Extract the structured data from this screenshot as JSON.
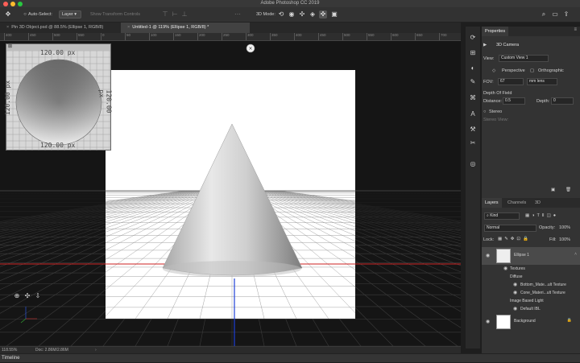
{
  "app": {
    "title": "Adobe Photoshop CC 2019"
  },
  "options_bar": {
    "auto_select_label": "Auto-Select:",
    "auto_select_value": "Layer",
    "show_transform_label": "Show Transform Controls",
    "mode_label": "3D Mode:"
  },
  "tabs": [
    {
      "label": "Pin 3D Object.psd @ 88.5% (Ellipse 1, RGB/8)",
      "active": false
    },
    {
      "label": "Untitled-1 @ 119% (Ellipse 1, RGB/8) *",
      "active": true
    }
  ],
  "ruler": {
    "ticks": [
      "400",
      "450",
      "500",
      "550",
      "0",
      "50",
      "100",
      "150",
      "200",
      "250",
      "300",
      "350",
      "400",
      "450",
      "500",
      "550",
      "600",
      "650",
      "700"
    ]
  },
  "texture_preview": {
    "top": "120.00 px",
    "left": "120.00 px",
    "right": "120.00 px",
    "bottom": "120.00 px"
  },
  "status": {
    "zoom": "118.55%",
    "doc": "Doc: 2.86M/2.86M"
  },
  "timeline": {
    "label": "Timeline"
  },
  "properties": {
    "tab": "Properties",
    "header": "3D Camera",
    "view_label": "View:",
    "view_value": "Custom View 1",
    "perspective": "Perspective",
    "orthographic": "Orthographic",
    "fov_label": "FOV:",
    "fov_value": "67",
    "fov_unit": "mm lens",
    "dof_label": "Depth Of Field",
    "distance_label": "Distance:",
    "distance_value": "0.5",
    "depth_label": "Depth:",
    "depth_value": "0",
    "stereo_label": "Stereo",
    "stereo_view_label": "Stereo View:"
  },
  "layers": {
    "tabs": [
      "Layers",
      "Channels",
      "3D"
    ],
    "kind_label": "Kind",
    "blend_mode": "Normal",
    "opacity_label": "Opacity:",
    "opacity_value": "100%",
    "lock_label": "Lock:",
    "fill_label": "Fill:",
    "fill_value": "100%",
    "items": [
      {
        "label": "Ellipse 1",
        "level": 0
      },
      {
        "label": "Textures",
        "level": 1
      },
      {
        "label": "Diffuse",
        "level": 2
      },
      {
        "label": "Bottom_Mate...ult Texture",
        "level": 3
      },
      {
        "label": "Cone_Materi...ult Texture",
        "level": 3
      },
      {
        "label": "Image Based Light",
        "level": 2
      },
      {
        "label": "Default IBL",
        "level": 3
      },
      {
        "label": "Background",
        "level": 0
      }
    ]
  },
  "colors": {
    "accent": "#1473e6",
    "horizon_red": "#cc2222",
    "axis_blue": "#1f3fd6"
  }
}
